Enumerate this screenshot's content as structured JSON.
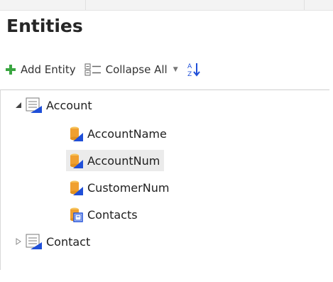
{
  "panel": {
    "title": "Entities"
  },
  "toolbar": {
    "add_label": "Add Entity",
    "collapse_label": "Collapse All"
  },
  "tree": {
    "nodes": [
      {
        "label": "Account",
        "expanded": true,
        "icon": "entity-icon",
        "children": [
          {
            "label": "AccountName",
            "icon": "field-icon"
          },
          {
            "label": "AccountNum",
            "icon": "field-icon",
            "selected": true
          },
          {
            "label": "CustomerNum",
            "icon": "field-icon"
          },
          {
            "label": "Contacts",
            "icon": "collection-icon"
          }
        ]
      },
      {
        "label": "Contact",
        "expanded": false,
        "icon": "entity-icon",
        "children": []
      }
    ]
  },
  "colors": {
    "add_green": "#3aa641",
    "entity_blue": "#1f4fd8",
    "field_orange": "#f0a030",
    "selection_bg": "#ebebeb"
  }
}
